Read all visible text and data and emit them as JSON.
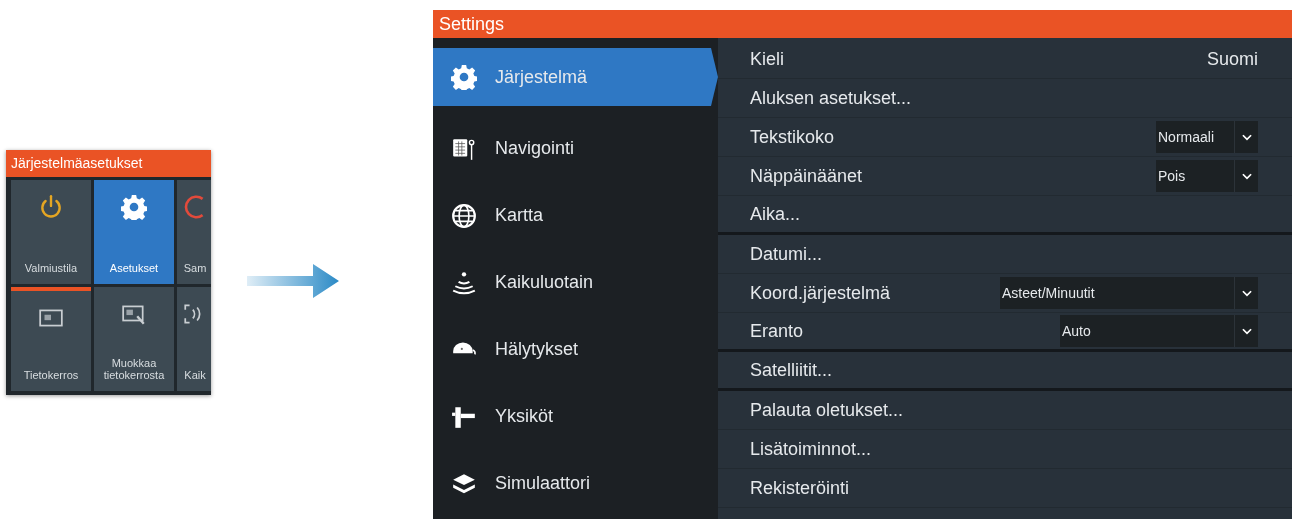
{
  "system_panel": {
    "title": "Järjestelmäasetukset",
    "tiles": [
      {
        "label": "Valmiustila",
        "selected": false,
        "focused": false
      },
      {
        "label": "Asetukset",
        "selected": true,
        "focused": false
      },
      {
        "label": "Sam",
        "selected": false,
        "focused": false
      },
      {
        "label": "Tietokerros",
        "selected": false,
        "focused": true
      },
      {
        "label": "Muokkaa tietokerrosta",
        "selected": false,
        "focused": false
      },
      {
        "label": "Kaik",
        "selected": false,
        "focused": false
      }
    ]
  },
  "settings_window": {
    "title": "Settings",
    "sidebar": {
      "items": [
        {
          "label": "Järjestelmä",
          "selected": true
        },
        {
          "label": "Navigointi",
          "selected": false
        },
        {
          "label": "Kartta",
          "selected": false
        },
        {
          "label": "Kaikuluotain",
          "selected": false
        },
        {
          "label": "Hälytykset",
          "selected": false
        },
        {
          "label": "Yksiköt",
          "selected": false
        },
        {
          "label": "Simulaattori",
          "selected": false
        }
      ]
    },
    "rows": [
      {
        "kind": "value",
        "label": "Kieli",
        "value": "Suomi",
        "divider_after": false
      },
      {
        "kind": "link",
        "label": "Aluksen asetukset...",
        "divider_after": false
      },
      {
        "kind": "dropdown",
        "label": "Tekstikoko",
        "value": "Normaali",
        "divider_after": false
      },
      {
        "kind": "dropdown",
        "label": "Näppäinäänet",
        "value": "Pois",
        "divider_after": false
      },
      {
        "kind": "link",
        "label": "Aika...",
        "divider_after": true
      },
      {
        "kind": "link",
        "label": "Datumi...",
        "divider_after": false
      },
      {
        "kind": "dropdown",
        "label": "Koord.järjestelmä",
        "value": "Asteet/Minuutit",
        "divider_after": false
      },
      {
        "kind": "dropdown",
        "label": "Eranto",
        "value": "Auto",
        "divider_after": true
      },
      {
        "kind": "link",
        "label": "Satelliitit...",
        "divider_after": true
      },
      {
        "kind": "link",
        "label": "Palauta oletukset...",
        "divider_after": false
      },
      {
        "kind": "link",
        "label": "Lisätoiminnot...",
        "divider_after": false
      },
      {
        "kind": "link",
        "label": "Rekisteröinti",
        "divider_after": false
      }
    ]
  }
}
